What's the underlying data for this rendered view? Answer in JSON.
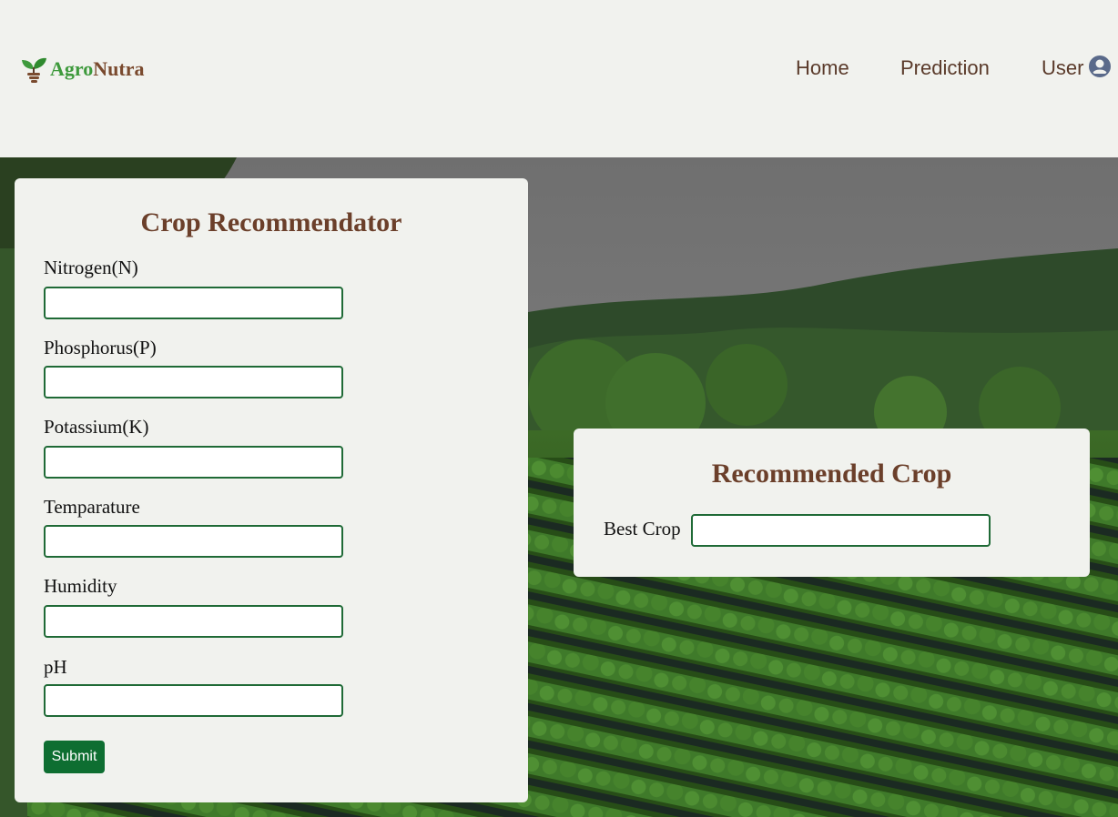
{
  "brand": {
    "part1": "Agro",
    "part2": "Nutra",
    "color1": "#3e9a3c",
    "color2": "#7a4a2e"
  },
  "nav": {
    "home": "Home",
    "prediction": "Prediction",
    "user": "User"
  },
  "form": {
    "title": "Crop Recommendator",
    "fields": [
      {
        "label": "Nitrogen(N)",
        "value": ""
      },
      {
        "label": "Phosphorus(P)",
        "value": ""
      },
      {
        "label": "Potassium(K)",
        "value": ""
      },
      {
        "label": "Temparature",
        "value": ""
      },
      {
        "label": "Humidity",
        "value": ""
      },
      {
        "label": "pH",
        "value": ""
      }
    ],
    "submit": "Submit"
  },
  "result": {
    "title": "Recommended Crop",
    "label": "Best Crop",
    "value": ""
  },
  "colors": {
    "accent": "#0e6e31",
    "heading": "#6b3f2a",
    "background": "#f1f2ee",
    "nav_text": "#5a3a2a"
  },
  "icons": {
    "logo": "sprout-logo-icon",
    "user": "user-avatar-icon"
  }
}
